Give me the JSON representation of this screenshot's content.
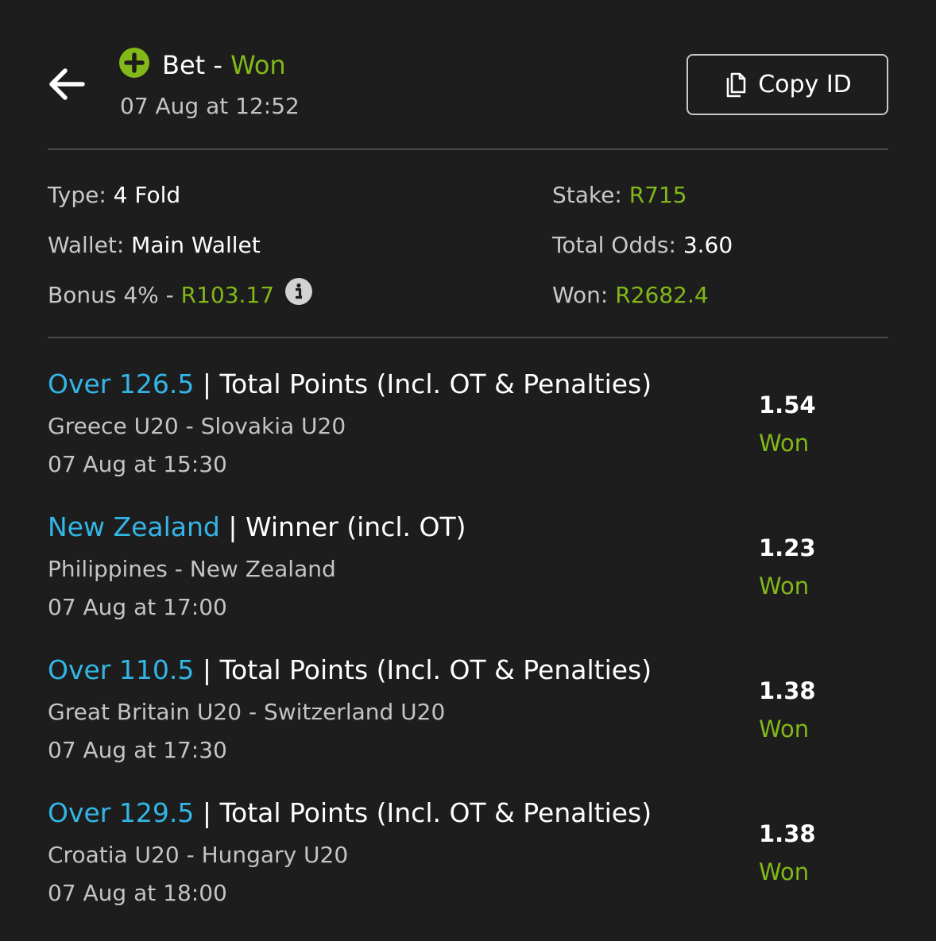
{
  "header": {
    "bet_label": "Bet",
    "separator": "-",
    "status": "Won",
    "placed_time": "07 Aug at 12:52",
    "copy_button_label": "Copy ID"
  },
  "summary": {
    "type_label": "Type:",
    "type_value": "4 Fold",
    "wallet_label": "Wallet:",
    "wallet_value": "Main Wallet",
    "bonus_label": "Bonus 4% -",
    "bonus_value": "R103.17",
    "stake_label": "Stake:",
    "stake_value": "R715",
    "odds_label": "Total Odds:",
    "odds_value": "3.60",
    "won_label": "Won:",
    "won_value": "R2682.4"
  },
  "legs": [
    {
      "selection": "Over 126.5",
      "sep": "|",
      "market": "Total Points (Incl. OT & Penalties)",
      "event": "Greece U20 - Slovakia U20",
      "time": "07 Aug at 15:30",
      "odds": "1.54",
      "result": "Won"
    },
    {
      "selection": "New Zealand",
      "sep": "|",
      "market": "Winner (incl. OT)",
      "event": "Philippines - New Zealand",
      "time": "07 Aug at 17:00",
      "odds": "1.23",
      "result": "Won"
    },
    {
      "selection": "Over 110.5",
      "sep": "|",
      "market": "Total Points (Incl. OT & Penalties)",
      "event": "Great Britain U20 - Switzerland U20",
      "time": "07 Aug at 17:30",
      "odds": "1.38",
      "result": "Won"
    },
    {
      "selection": "Over 129.5",
      "sep": "|",
      "market": "Total Points (Incl. OT & Penalties)",
      "event": "Croatia U20 - Hungary U20",
      "time": "07 Aug at 18:00",
      "odds": "1.38",
      "result": "Won"
    }
  ],
  "icons": {
    "back": "arrow-left-icon",
    "status": "plus-circle-icon",
    "copy": "copy-icon",
    "info": "info-icon"
  },
  "colors": {
    "background": "#1d1d1d",
    "accent_green": "#82b818",
    "selection_blue": "#33b6e6",
    "divider": "#4a4a4a"
  }
}
